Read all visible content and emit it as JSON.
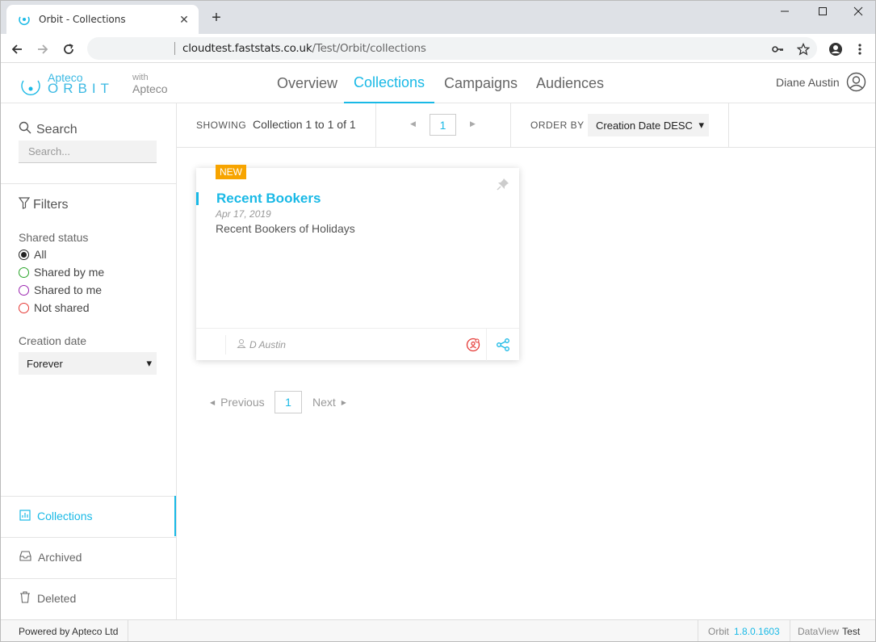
{
  "browser": {
    "tab_title": "Orbit - Collections",
    "new_tab": "+",
    "url_host": "cloudtest.faststats.co.uk",
    "url_path": "/Test/Orbit/collections"
  },
  "header": {
    "logo_small": "Apteco",
    "logo_big": "ORBIT",
    "with_label": "with",
    "with_brand": "Apteco",
    "nav": [
      "Overview",
      "Collections",
      "Campaigns",
      "Audiences"
    ],
    "active_nav": "Collections",
    "user_name": "Diane Austin"
  },
  "sidebar": {
    "search_label": "Search",
    "search_placeholder": "Search...",
    "filters_label": "Filters",
    "shared_status_label": "Shared status",
    "shared_options": [
      {
        "label": "All",
        "color": "#222222",
        "selected": true
      },
      {
        "label": "Shared by me",
        "color": "#2aa52a",
        "selected": false
      },
      {
        "label": "Shared to me",
        "color": "#9b27b0",
        "selected": false
      },
      {
        "label": "Not shared",
        "color": "#e53935",
        "selected": false
      }
    ],
    "creation_date_label": "Creation date",
    "creation_date_value": "Forever",
    "nav": [
      {
        "label": "Collections",
        "icon": "collections-icon",
        "active": true
      },
      {
        "label": "Archived",
        "icon": "inbox-icon",
        "active": false
      },
      {
        "label": "Deleted",
        "icon": "trash-icon",
        "active": false
      }
    ]
  },
  "toolbar": {
    "showing_label": "SHOWING",
    "showing_text": "Collection 1 to 1 of 1",
    "page": "1",
    "order_by_label": "ORDER BY",
    "order_by_value": "Creation Date DESC"
  },
  "card": {
    "badge": "NEW",
    "title": "Recent Bookers",
    "date": "Apr 17, 2019",
    "description": "Recent Bookers of Holidays",
    "owner": "D Austin"
  },
  "pager": {
    "previous": "Previous",
    "page": "1",
    "next": "Next"
  },
  "footer": {
    "powered_by": "Powered by Apteco Ltd",
    "app_name": "Orbit",
    "version": "1.8.0.1603",
    "dataview_label": "DataView",
    "dataview_value": "Test"
  },
  "colors": {
    "accent": "#19b9e6",
    "badge": "#f7a400"
  }
}
